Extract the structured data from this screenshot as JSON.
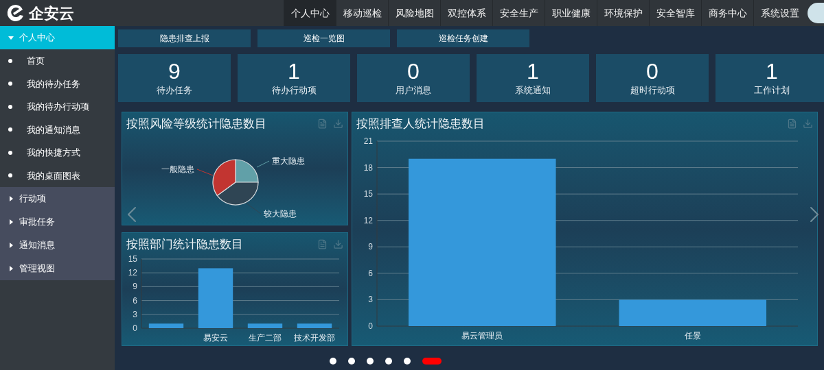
{
  "header": {
    "logo": "企安云",
    "nav": [
      {
        "label": "个人中心",
        "selected": true
      },
      {
        "label": "移动巡检",
        "selected": false
      },
      {
        "label": "风险地图",
        "selected": false
      },
      {
        "label": "双控体系",
        "selected": false
      },
      {
        "label": "安全生产",
        "selected": false
      },
      {
        "label": "职业健康",
        "selected": false
      },
      {
        "label": "环境保护",
        "selected": false
      },
      {
        "label": "安全智库",
        "selected": false
      },
      {
        "label": "商务中心",
        "selected": false
      },
      {
        "label": "系统设置",
        "selected": false
      }
    ]
  },
  "sidebar": {
    "items": [
      {
        "label": "个人中心",
        "expanded": true,
        "selected": true,
        "children": [
          {
            "label": "首页"
          },
          {
            "label": "我的待办任务"
          },
          {
            "label": "我的待办行动项"
          },
          {
            "label": "我的通知消息"
          },
          {
            "label": "我的快捷方式"
          },
          {
            "label": "我的桌面图表"
          }
        ]
      },
      {
        "label": "行动项",
        "expanded": false,
        "selected": false
      },
      {
        "label": "审批任务",
        "expanded": false,
        "selected": false
      },
      {
        "label": "通知消息",
        "expanded": false,
        "selected": false
      },
      {
        "label": "管理视图",
        "expanded": false,
        "selected": false
      }
    ]
  },
  "quick_buttons": [
    "隐患排查上报",
    "巡检一览图",
    "巡检任务创建"
  ],
  "stats": [
    {
      "value": "9",
      "label": "待办任务"
    },
    {
      "value": "1",
      "label": "待办行动项"
    },
    {
      "value": "0",
      "label": "用户消息"
    },
    {
      "value": "1",
      "label": "系统通知"
    },
    {
      "value": "0",
      "label": "超时行动项"
    },
    {
      "value": "1",
      "label": "工作计划"
    }
  ],
  "panels": [
    {
      "title": "按照风险等级统计隐患数目",
      "kind": "pie",
      "slices": [
        {
          "label": "重大隐患",
          "color": "#61a0a8"
        },
        {
          "label": "较大隐患",
          "color": "#2f4554"
        },
        {
          "label": "一般隐患",
          "color": "#c23531"
        }
      ]
    },
    {
      "title": "按照部门统计隐患数目",
      "kind": "bar",
      "chart_data": {
        "type": "bar",
        "categories": [
          null,
          "易安云",
          "生产二部",
          "技术开发部"
        ],
        "grid": true,
        "series": [
          {
            "color": "#3498db",
            "values": [
              1,
              13,
              1,
              1
            ]
          }
        ],
        "ylim": [
          0,
          15
        ],
        "yticks": [
          0,
          3,
          6,
          9,
          12,
          15
        ]
      }
    },
    {
      "title": "按照排查人统计隐患数目",
      "kind": "bar",
      "chart_data": {
        "type": "bar",
        "categories": [
          "易云管理员",
          "任景"
        ],
        "grid": true,
        "series": [
          {
            "color": "#3498db",
            "values": [
              19,
              3
            ]
          }
        ],
        "ylim": [
          0,
          21
        ],
        "yticks": [
          0,
          3,
          6,
          9,
          12,
          15,
          18,
          21
        ]
      }
    }
  ],
  "carousel": {
    "pages": [
      {
        "selected": false
      },
      {
        "selected": false
      },
      {
        "selected": false
      },
      {
        "selected": false
      },
      {
        "selected": false
      },
      {
        "selected": true
      }
    ]
  }
}
